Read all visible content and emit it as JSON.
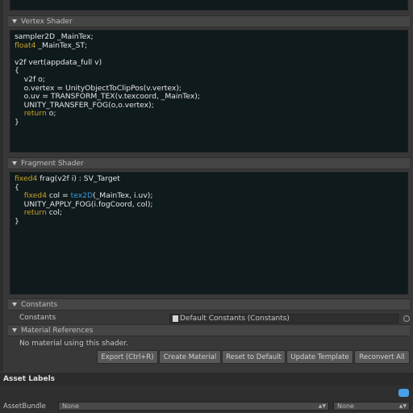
{
  "sections": {
    "vertex_header": "Vertex Shader",
    "fragment_header": "Fragment Shader",
    "constants_header": "Constants",
    "material_references_header": "Material References"
  },
  "vertex_code": [
    [
      {
        "t": "sampler2D _MainTex;",
        "c": "plain"
      }
    ],
    [
      {
        "t": "float4",
        "c": "kw"
      },
      {
        "t": " _MainTex_ST;",
        "c": "plain"
      }
    ],
    [
      {
        "t": "",
        "c": "plain"
      }
    ],
    [
      {
        "t": "v2f vert(appdata_full v)",
        "c": "plain"
      }
    ],
    [
      {
        "t": "{",
        "c": "plain"
      }
    ],
    [
      {
        "t": "    v2f o;",
        "c": "plain"
      }
    ],
    [
      {
        "t": "    o.vertex = UnityObjectToClipPos(v.vertex);",
        "c": "plain"
      }
    ],
    [
      {
        "t": "    o.uv = TRANSFORM_TEX(v.texcoord, _MainTex);",
        "c": "plain"
      }
    ],
    [
      {
        "t": "    UNITY_TRANSFER_FOG(o,o.vertex);",
        "c": "plain"
      }
    ],
    [
      {
        "t": "    ",
        "c": "plain"
      },
      {
        "t": "return",
        "c": "kw"
      },
      {
        "t": " o;",
        "c": "plain"
      }
    ],
    [
      {
        "t": "}",
        "c": "plain"
      }
    ]
  ],
  "fragment_code": [
    [
      {
        "t": "fixed4",
        "c": "kw"
      },
      {
        "t": " frag(v2f i) : SV_Target",
        "c": "plain"
      }
    ],
    [
      {
        "t": "{",
        "c": "plain"
      }
    ],
    [
      {
        "t": "    ",
        "c": "plain"
      },
      {
        "t": "fixed4",
        "c": "kw"
      },
      {
        "t": " col = ",
        "c": "plain"
      },
      {
        "t": "tex2D",
        "c": "fn"
      },
      {
        "t": "(_MainTex, i.uv);",
        "c": "plain"
      }
    ],
    [
      {
        "t": "    UNITY_APPLY_FOG(i.fogCoord, col);",
        "c": "plain"
      }
    ],
    [
      {
        "t": "    ",
        "c": "plain"
      },
      {
        "t": "return",
        "c": "kw"
      },
      {
        "t": " col;",
        "c": "plain"
      }
    ],
    [
      {
        "t": "}",
        "c": "plain"
      }
    ]
  ],
  "constants": {
    "label": "Constants",
    "value": "Default Constants (Constants)"
  },
  "material_references": {
    "message": "No material using this shader."
  },
  "buttons": {
    "export": "Export (Ctrl+R)",
    "create_material": "Create Material",
    "reset_to_default": "Reset to Default",
    "update_template": "Update Template",
    "reconvert_all": "Reconvert All"
  },
  "asset_labels": {
    "title": "Asset Labels",
    "assetbundle_label": "AssetBundle",
    "assetbundle_value": "None",
    "variant_value": "None"
  },
  "colors": {
    "keyword": "#c9a227",
    "function": "#3f9ad8",
    "code_bg": "#0f1a1d",
    "label_icon": "#4aa0e6"
  }
}
